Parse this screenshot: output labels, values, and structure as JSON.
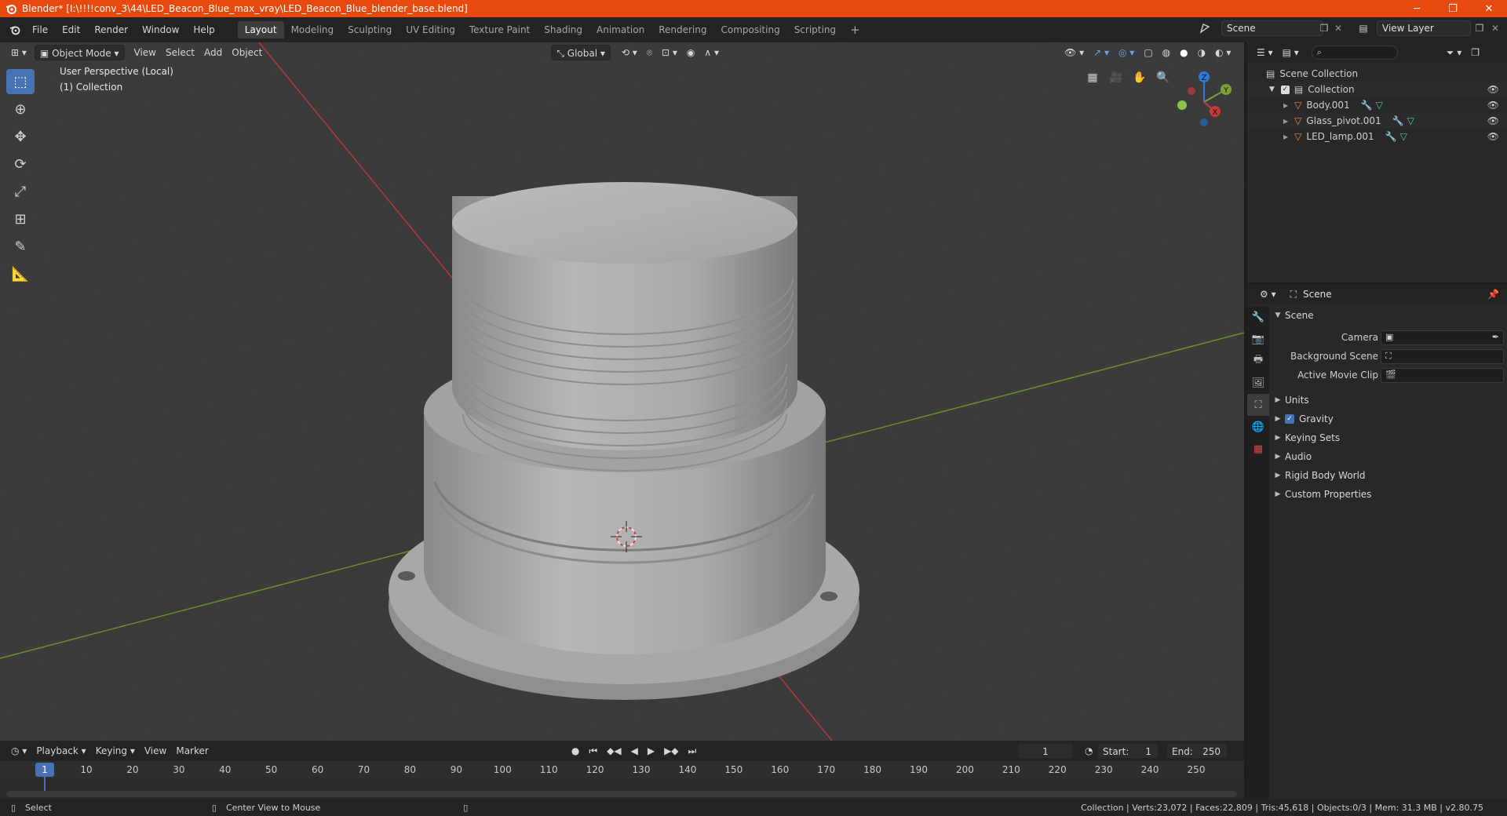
{
  "window": {
    "title": "Blender* [I:\\!!!!conv_3\\44\\LED_Beacon_Blue_max_vray\\LED_Beacon_Blue_blender_base.blend]",
    "minimize": "─",
    "maximize": "❐",
    "close": "✕"
  },
  "menu": [
    "File",
    "Edit",
    "Render",
    "Window",
    "Help"
  ],
  "workspaces": [
    "Layout",
    "Modeling",
    "Sculpting",
    "UV Editing",
    "Texture Paint",
    "Shading",
    "Animation",
    "Rendering",
    "Compositing",
    "Scripting"
  ],
  "add_workspace": "+",
  "scene_field": "Scene",
  "view_layer_field": "View Layer",
  "viewport": {
    "mode": "Object Mode",
    "menus": [
      "View",
      "Select",
      "Add",
      "Object"
    ],
    "orientation": "Global",
    "perspective_text": "User Perspective (Local)",
    "collection_text": "(1) Collection",
    "gizmo": {
      "z": "Z",
      "y": "Y",
      "x": "X"
    }
  },
  "timeline": {
    "menus": [
      "Playback",
      "Keying",
      "View",
      "Marker"
    ],
    "current_frame": "1",
    "start_label": "Start:",
    "start_value": "1",
    "end_label": "End:",
    "end_value": "250",
    "ticks": [
      "1",
      "10",
      "20",
      "30",
      "40",
      "50",
      "60",
      "70",
      "80",
      "90",
      "100",
      "110",
      "120",
      "130",
      "140",
      "150",
      "160",
      "170",
      "180",
      "190",
      "200",
      "210",
      "220",
      "230",
      "240",
      "250"
    ],
    "tick_frames": [
      1,
      10,
      20,
      30,
      40,
      50,
      60,
      70,
      80,
      90,
      100,
      110,
      120,
      130,
      140,
      150,
      160,
      170,
      180,
      190,
      200,
      210,
      220,
      230,
      240,
      250
    ]
  },
  "outliner": {
    "scene_collection": "Scene Collection",
    "collection": "Collection",
    "objects": [
      "Body.001",
      "Glass_pivot.001",
      "LED_lamp.001"
    ]
  },
  "properties": {
    "header": "Scene",
    "panel_title": "Scene",
    "camera_label": "Camera",
    "background_scene_label": "Background Scene",
    "active_movie_clip_label": "Active Movie Clip",
    "subpanels": [
      "Units",
      "Gravity",
      "Keying Sets",
      "Audio",
      "Rigid Body World",
      "Custom Properties"
    ]
  },
  "status": {
    "select": "Select",
    "center_view": "Center View to Mouse",
    "stats": "Collection | Verts:23,072 | Faces:22,809 | Tris:45,618 | Objects:0/3 | Mem: 31.3 MB | v2.80.75"
  },
  "colors": {
    "accent": "#4772b3",
    "title_bar": "#e8490f",
    "x_axis": "#c83a3a",
    "y_axis": "#7aa03a",
    "z_axis": "#2d7bd6"
  }
}
